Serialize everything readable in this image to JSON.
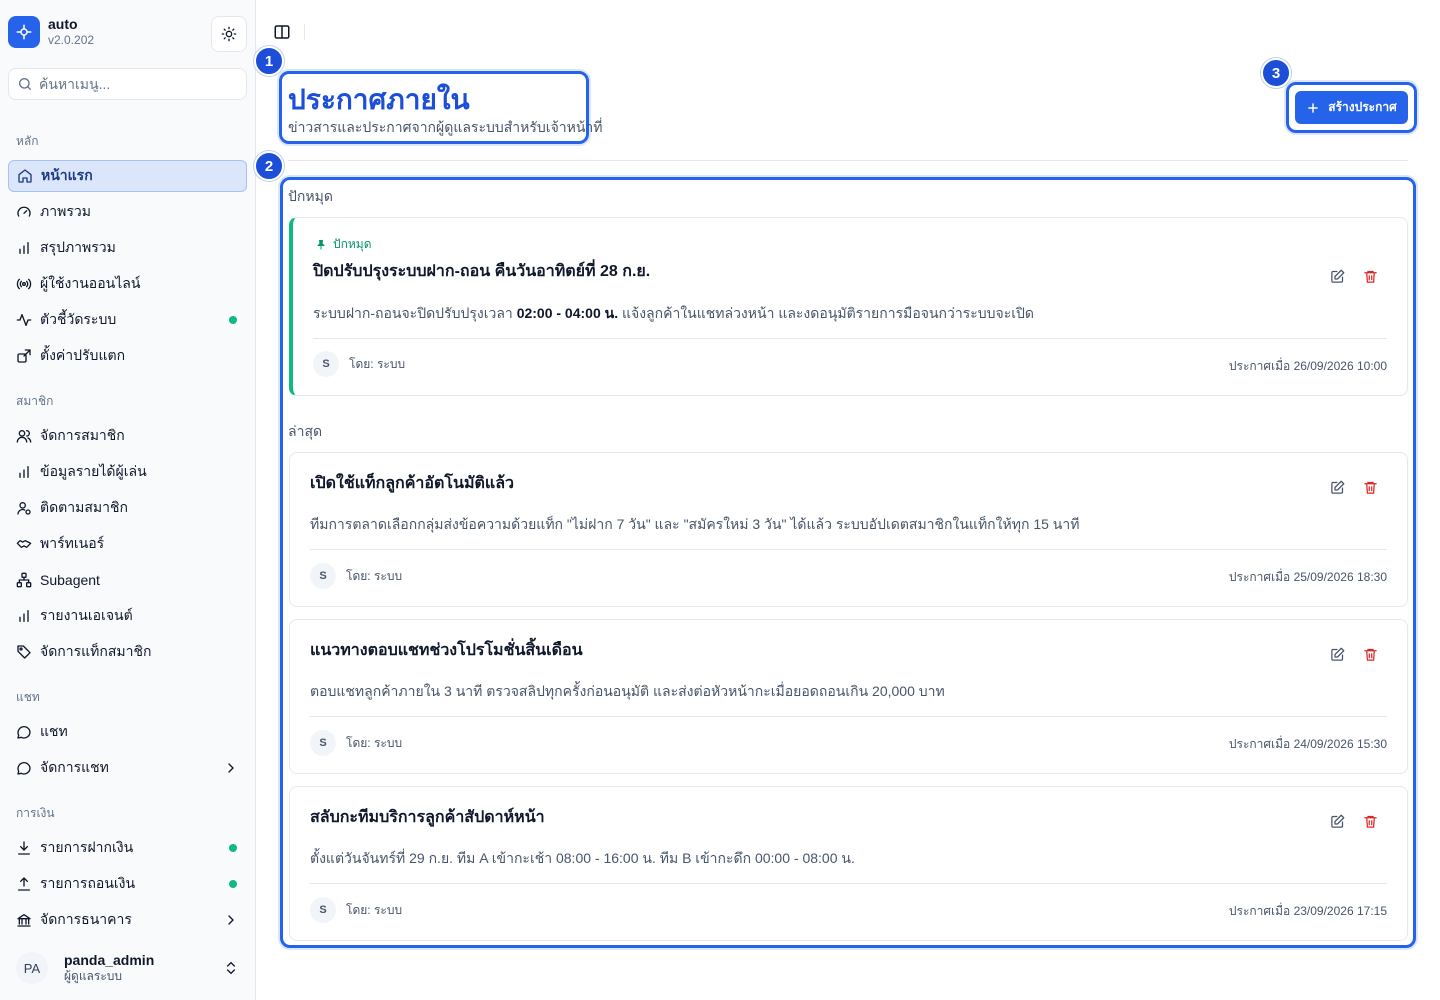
{
  "brand": {
    "name": "auto",
    "version": "v2.0.202"
  },
  "search": {
    "placeholder": "ค้นหาเมนู..."
  },
  "sidebar": {
    "sections": [
      {
        "label": "หลัก",
        "items": [
          {
            "label": "หน้าแรก",
            "icon": "home-icon",
            "active": true
          },
          {
            "label": "ภาพรวม",
            "icon": "gauge-icon"
          },
          {
            "label": "สรุปภาพรวม",
            "icon": "bar-chart-icon"
          },
          {
            "label": "ผู้ใช้งานออนไลน์",
            "icon": "radio-icon"
          },
          {
            "label": "ตัวชี้วัดระบบ",
            "icon": "activity-icon",
            "status": "online"
          },
          {
            "label": "ตั้งค่าปรับแตก",
            "icon": "settings-box-icon"
          }
        ]
      },
      {
        "label": "สมาชิก",
        "items": [
          {
            "label": "จัดการสมาชิก",
            "icon": "users-icon"
          },
          {
            "label": "ข้อมูลรายได้ผู้เล่น",
            "icon": "bar-chart-icon"
          },
          {
            "label": "ติดตามสมาชิก",
            "icon": "user-search-icon"
          },
          {
            "label": "พาร์ทเนอร์",
            "icon": "handshake-icon"
          },
          {
            "label": "Subagent",
            "icon": "network-icon"
          },
          {
            "label": "รายงานเอเจนต์",
            "icon": "bar-chart-icon"
          },
          {
            "label": "จัดการแท็กสมาชิก",
            "icon": "tag-icon"
          }
        ]
      },
      {
        "label": "แชท",
        "items": [
          {
            "label": "แชท",
            "icon": "chat-icon"
          },
          {
            "label": "จัดการแชท",
            "icon": "chat-icon",
            "expandable": true
          }
        ]
      },
      {
        "label": "การเงิน",
        "items": [
          {
            "label": "รายการฝากเงิน",
            "icon": "download-icon",
            "status": "online"
          },
          {
            "label": "รายการถอนเงิน",
            "icon": "upload-icon",
            "status": "online"
          },
          {
            "label": "จัดการธนาคาร",
            "icon": "bank-icon",
            "expandable": true
          }
        ]
      }
    ]
  },
  "user": {
    "initials": "PA",
    "name": "panda_admin",
    "role": "ผู้ดูแลระบบ"
  },
  "header": {
    "title": "ประกาศภายใน",
    "subtitle": "ข่าวสารและประกาศจากผู้ดูแลระบบสำหรับเจ้าหน้าที่",
    "create_label": "สร้างประกาศ"
  },
  "badges": [
    "1",
    "2",
    "3"
  ],
  "groups": {
    "pinned": "ปักหมุด",
    "latest": "ล่าสุด"
  },
  "pinned_card": {
    "tag": "ปักหมุด",
    "title": "ปิดปรับปรุงระบบฝาก-ถอน คืนวันอาทิตย์ที่ 28 ก.ย.",
    "body_pre": "ระบบฝาก-ถอนจะปิดปรับปรุงเวลา ",
    "body_bold": "02:00 - 04:00 น.",
    "body_post": " แจ้งลูกค้าในแชทล่วงหน้า และงดอนุมัติรายการมือจนกว่าระบบจะเปิด",
    "author_initial": "S",
    "author": "โดย: ระบบ",
    "stamp": "ประกาศเมื่อ 26/09/2026 10:00"
  },
  "cards": [
    {
      "title": "เปิดใช้แท็กลูกค้าอัตโนมัติแล้ว",
      "body": "ทีมการตลาดเลือกกลุ่มส่งข้อความด้วยแท็ก \"ไม่ฝาก 7 วัน\" และ \"สมัครใหม่ 3 วัน\" ได้แล้ว ระบบอัปเดตสมาชิกในแท็กให้ทุก 15 นาที",
      "author_initial": "S",
      "author": "โดย: ระบบ",
      "stamp": "ประกาศเมื่อ 25/09/2026 18:30"
    },
    {
      "title": "แนวทางตอบแชทช่วงโปรโมชั่นสิ้นเดือน",
      "body": "ตอบแชทลูกค้าภายใน 3 นาที ตรวจสลิปทุกครั้งก่อนอนุมัติ และส่งต่อหัวหน้ากะเมื่อยอดถอนเกิน 20,000 บาท",
      "author_initial": "S",
      "author": "โดย: ระบบ",
      "stamp": "ประกาศเมื่อ 24/09/2026 15:30"
    },
    {
      "title": "สลับกะทีมบริการลูกค้าสัปดาห์หน้า",
      "body": "ตั้งแต่วันจันทร์ที่ 29 ก.ย. ทีม A เข้ากะเช้า 08:00 - 16:00 น. ทีม B เข้ากะดึก 00:00 - 08:00 น.",
      "author_initial": "S",
      "author": "โดย: ระบบ",
      "stamp": "ประกาศเมื่อ 23/09/2026 17:15"
    }
  ],
  "colors": {
    "accent": "#2563eb",
    "online": "#10b981",
    "delete": "#dc2626",
    "pinned": "#10b981"
  }
}
